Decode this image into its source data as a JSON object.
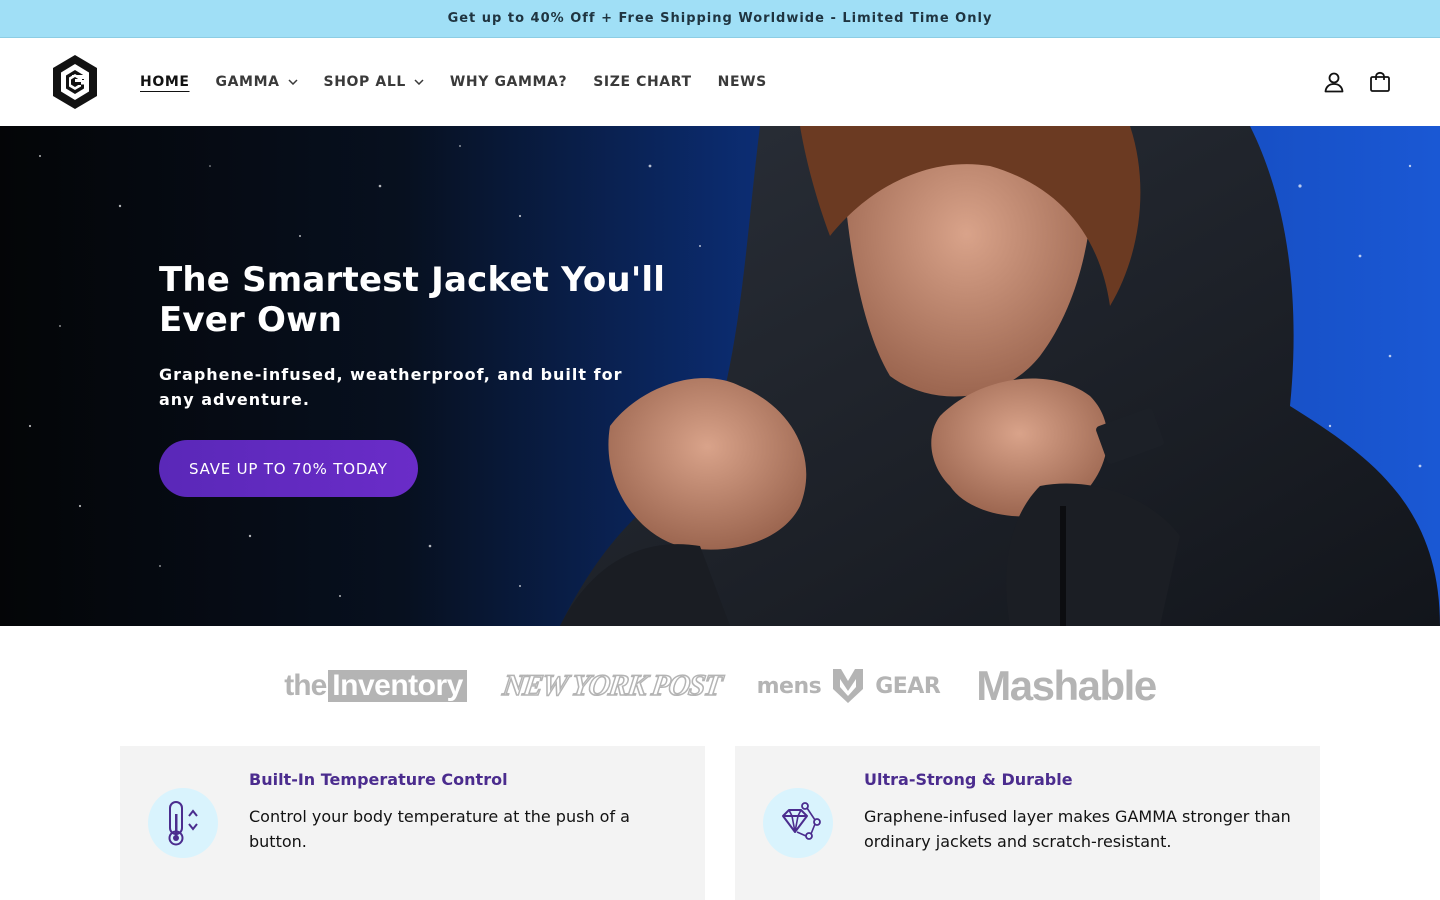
{
  "announcement": {
    "text": "Get up to 40% Off + Free Shipping Worldwide - Limited Time Only"
  },
  "header": {
    "logo_icon": "gamma-hexagon-g-logo",
    "nav": [
      {
        "label": "HOME",
        "active": true,
        "has_dropdown": false
      },
      {
        "label": "GAMMA",
        "active": false,
        "has_dropdown": true
      },
      {
        "label": "SHOP ALL",
        "active": false,
        "has_dropdown": true
      },
      {
        "label": "WHY GAMMA?",
        "active": false,
        "has_dropdown": false
      },
      {
        "label": "SIZE CHART",
        "active": false,
        "has_dropdown": false
      },
      {
        "label": "NEWS",
        "active": false,
        "has_dropdown": false
      }
    ],
    "icons": {
      "account": "user-icon",
      "cart": "cart-icon"
    }
  },
  "hero": {
    "title": "The Smartest Jacket You'll Ever Own",
    "subtitle": "Graphene-infused, weatherproof, and built for any adventure.",
    "cta_label": "SAVE UP TO 70% TODAY",
    "cta_color": "#5e29bd"
  },
  "press": {
    "logos": [
      {
        "name": "the Inventory",
        "the": "the",
        "word": "Inventory"
      },
      {
        "name": "New York Post",
        "text": "NEW YORK POST"
      },
      {
        "name": "Mens Gear",
        "left": "mens",
        "right": "GEAR"
      },
      {
        "name": "Mashable",
        "text": "Mashable"
      }
    ]
  },
  "features": [
    {
      "icon": "thermometer-icon",
      "title": "Built-In Temperature Control",
      "description": "Control your body temperature at the push of a button."
    },
    {
      "icon": "diamond-molecule-icon",
      "title": "Ultra-Strong & Durable",
      "description": "Graphene-infused layer makes GAMMA stronger than ordinary jackets and scratch-resistant."
    }
  ],
  "colors": {
    "announcement_bg": "#a0dff6",
    "accent_purple": "#5e29bd",
    "feature_title": "#4b2c8e",
    "feature_icon_bg": "#d9f3fd",
    "press_gray": "#b4b4b4"
  }
}
